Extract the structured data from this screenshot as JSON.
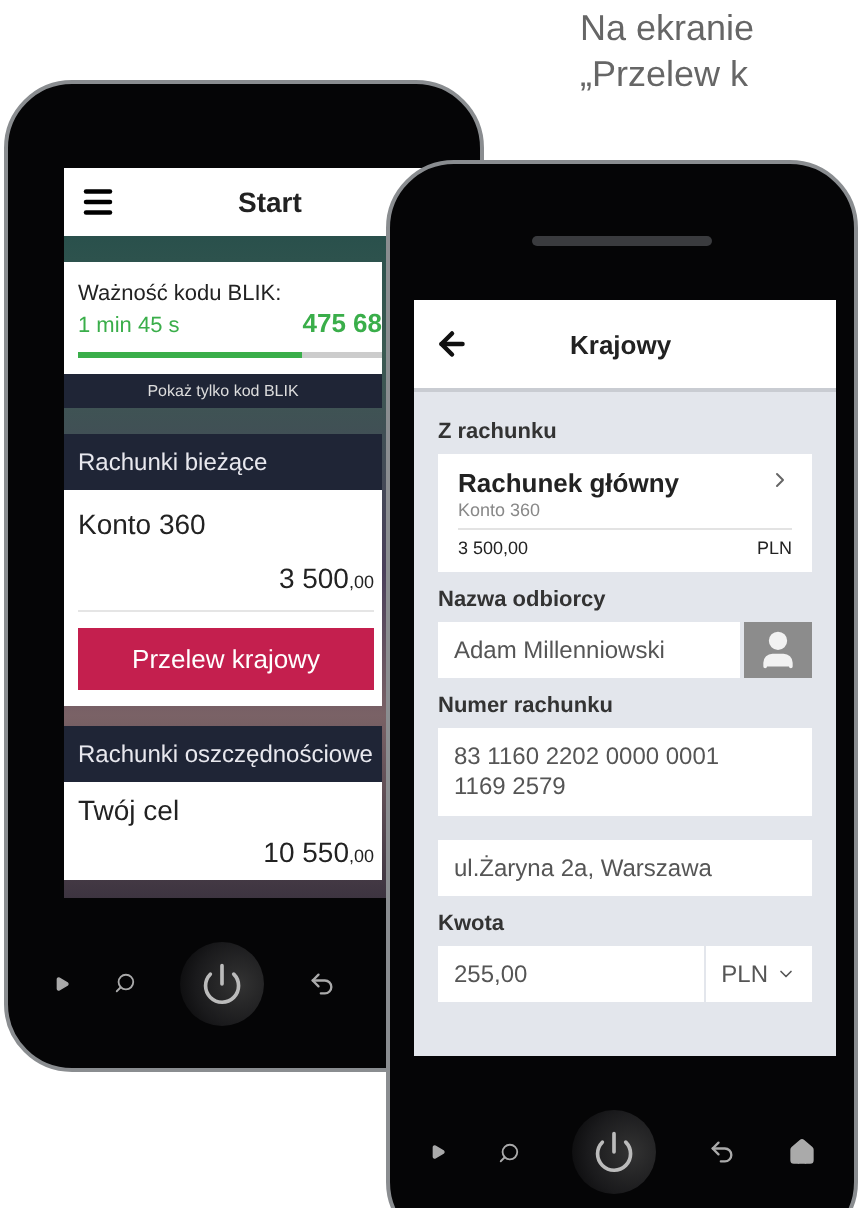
{
  "caption": [
    "Na ekranie",
    "„Przelew k"
  ],
  "start_screen": {
    "title": "Start",
    "blik": {
      "label": "Ważność kodu BLIK:",
      "time": "1 min 45 s",
      "code": "475 68",
      "level": 0.74,
      "show_only": "Pokaż tylko kod BLIK"
    },
    "sections": [
      {
        "title": "Rachunki bieżące",
        "accounts": [
          {
            "name": "Konto 360",
            "amount": "3 500",
            "fraction": ",00"
          }
        ],
        "button": "Przelew krajowy"
      },
      {
        "title": "Rachunki oszczędnościowe",
        "accounts": [
          {
            "name": "Twój cel",
            "amount": "10 550",
            "fraction": ",00"
          }
        ]
      }
    ]
  },
  "transfer_screen": {
    "title": "Krajowy",
    "from": {
      "label": "Z rachunku",
      "name": "Rachunek główny",
      "type": "Konto 360",
      "balance": "3 500,00",
      "currency": "PLN"
    },
    "recipient": {
      "label": "Nazwa odbiorcy",
      "value": "Adam Millenniowski"
    },
    "account": {
      "label": "Numer rachunku",
      "value": "83 1160 2202 0000 0001 1169 2579"
    },
    "address": {
      "value": "ul.Żaryna 2a, Warszawa"
    },
    "amount": {
      "label": "Kwota",
      "value": "255,00",
      "currency": "PLN"
    }
  }
}
